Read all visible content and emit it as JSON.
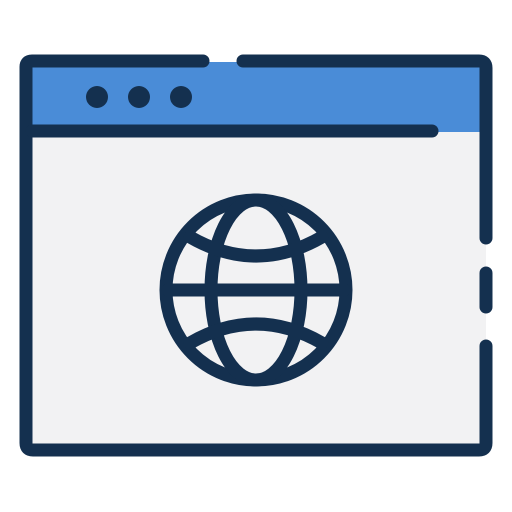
{
  "icon": {
    "name": "browser-globe-icon",
    "window_controls": [
      "control-dot-1",
      "control-dot-2",
      "control-dot-3"
    ]
  },
  "colors": {
    "outline": "#14304f",
    "title_bar": "#4a8cd7",
    "window_body": "#f2f2f3",
    "background": "#ffffff"
  }
}
